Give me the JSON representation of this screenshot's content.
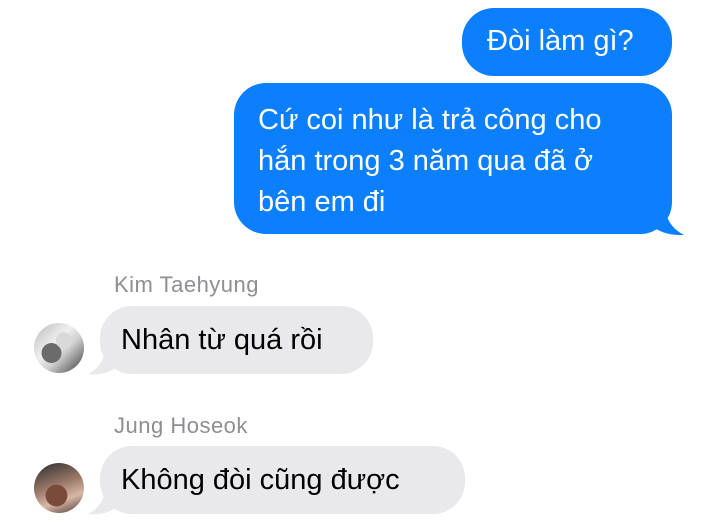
{
  "conversation": {
    "messages": [
      {
        "direction": "outgoing",
        "text": "Đòi làm gì?"
      },
      {
        "direction": "outgoing",
        "text_lines": [
          "Cứ coi như là trả công cho",
          "hắn trong 3 năm qua đã ở",
          "bên em đi"
        ]
      },
      {
        "direction": "incoming",
        "sender": "Kim Taehyung",
        "text": "Nhân từ quá rồi"
      },
      {
        "direction": "incoming",
        "sender": "Jung Hoseok",
        "text": "Không đòi cũng được"
      }
    ]
  },
  "colors": {
    "outgoing_bubble": "#0b7ffe",
    "incoming_bubble": "#e9e9eb",
    "sender_name": "#8e8e93",
    "background": "#ffffff"
  }
}
